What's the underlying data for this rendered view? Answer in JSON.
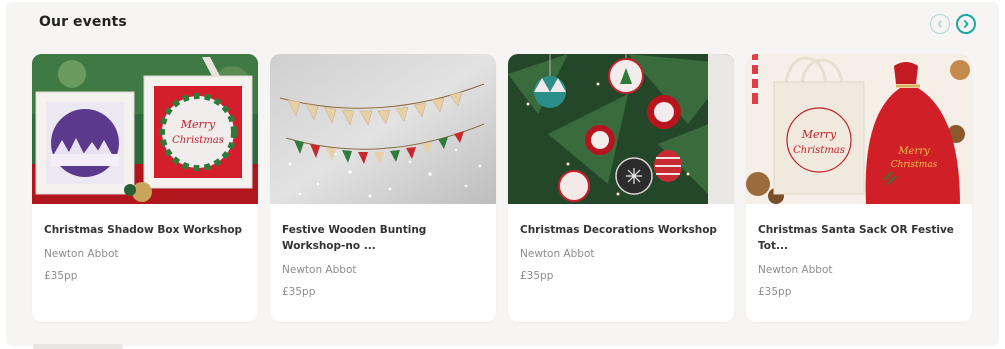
{
  "section": {
    "title": "Our events"
  },
  "nav": {
    "prev_icon": "chevron-left-icon",
    "next_icon": "chevron-right-icon",
    "accent": "#1ca7a1"
  },
  "events": [
    {
      "title": "Christmas Shadow Box Workshop",
      "location": "Newton Abbot",
      "price": "£35pp"
    },
    {
      "title": "Festive Wooden Bunting Workshop-no ...",
      "location": "Newton Abbot",
      "price": "£35pp"
    },
    {
      "title": "Christmas Decorations Workshop",
      "location": "Newton Abbot",
      "price": "£35pp"
    },
    {
      "title": "Christmas Santa Sack OR Festive Tot...",
      "location": "Newton Abbot",
      "price": "£35pp"
    }
  ],
  "image_text": {
    "merry": "Merry",
    "christmas": "Christmas"
  }
}
